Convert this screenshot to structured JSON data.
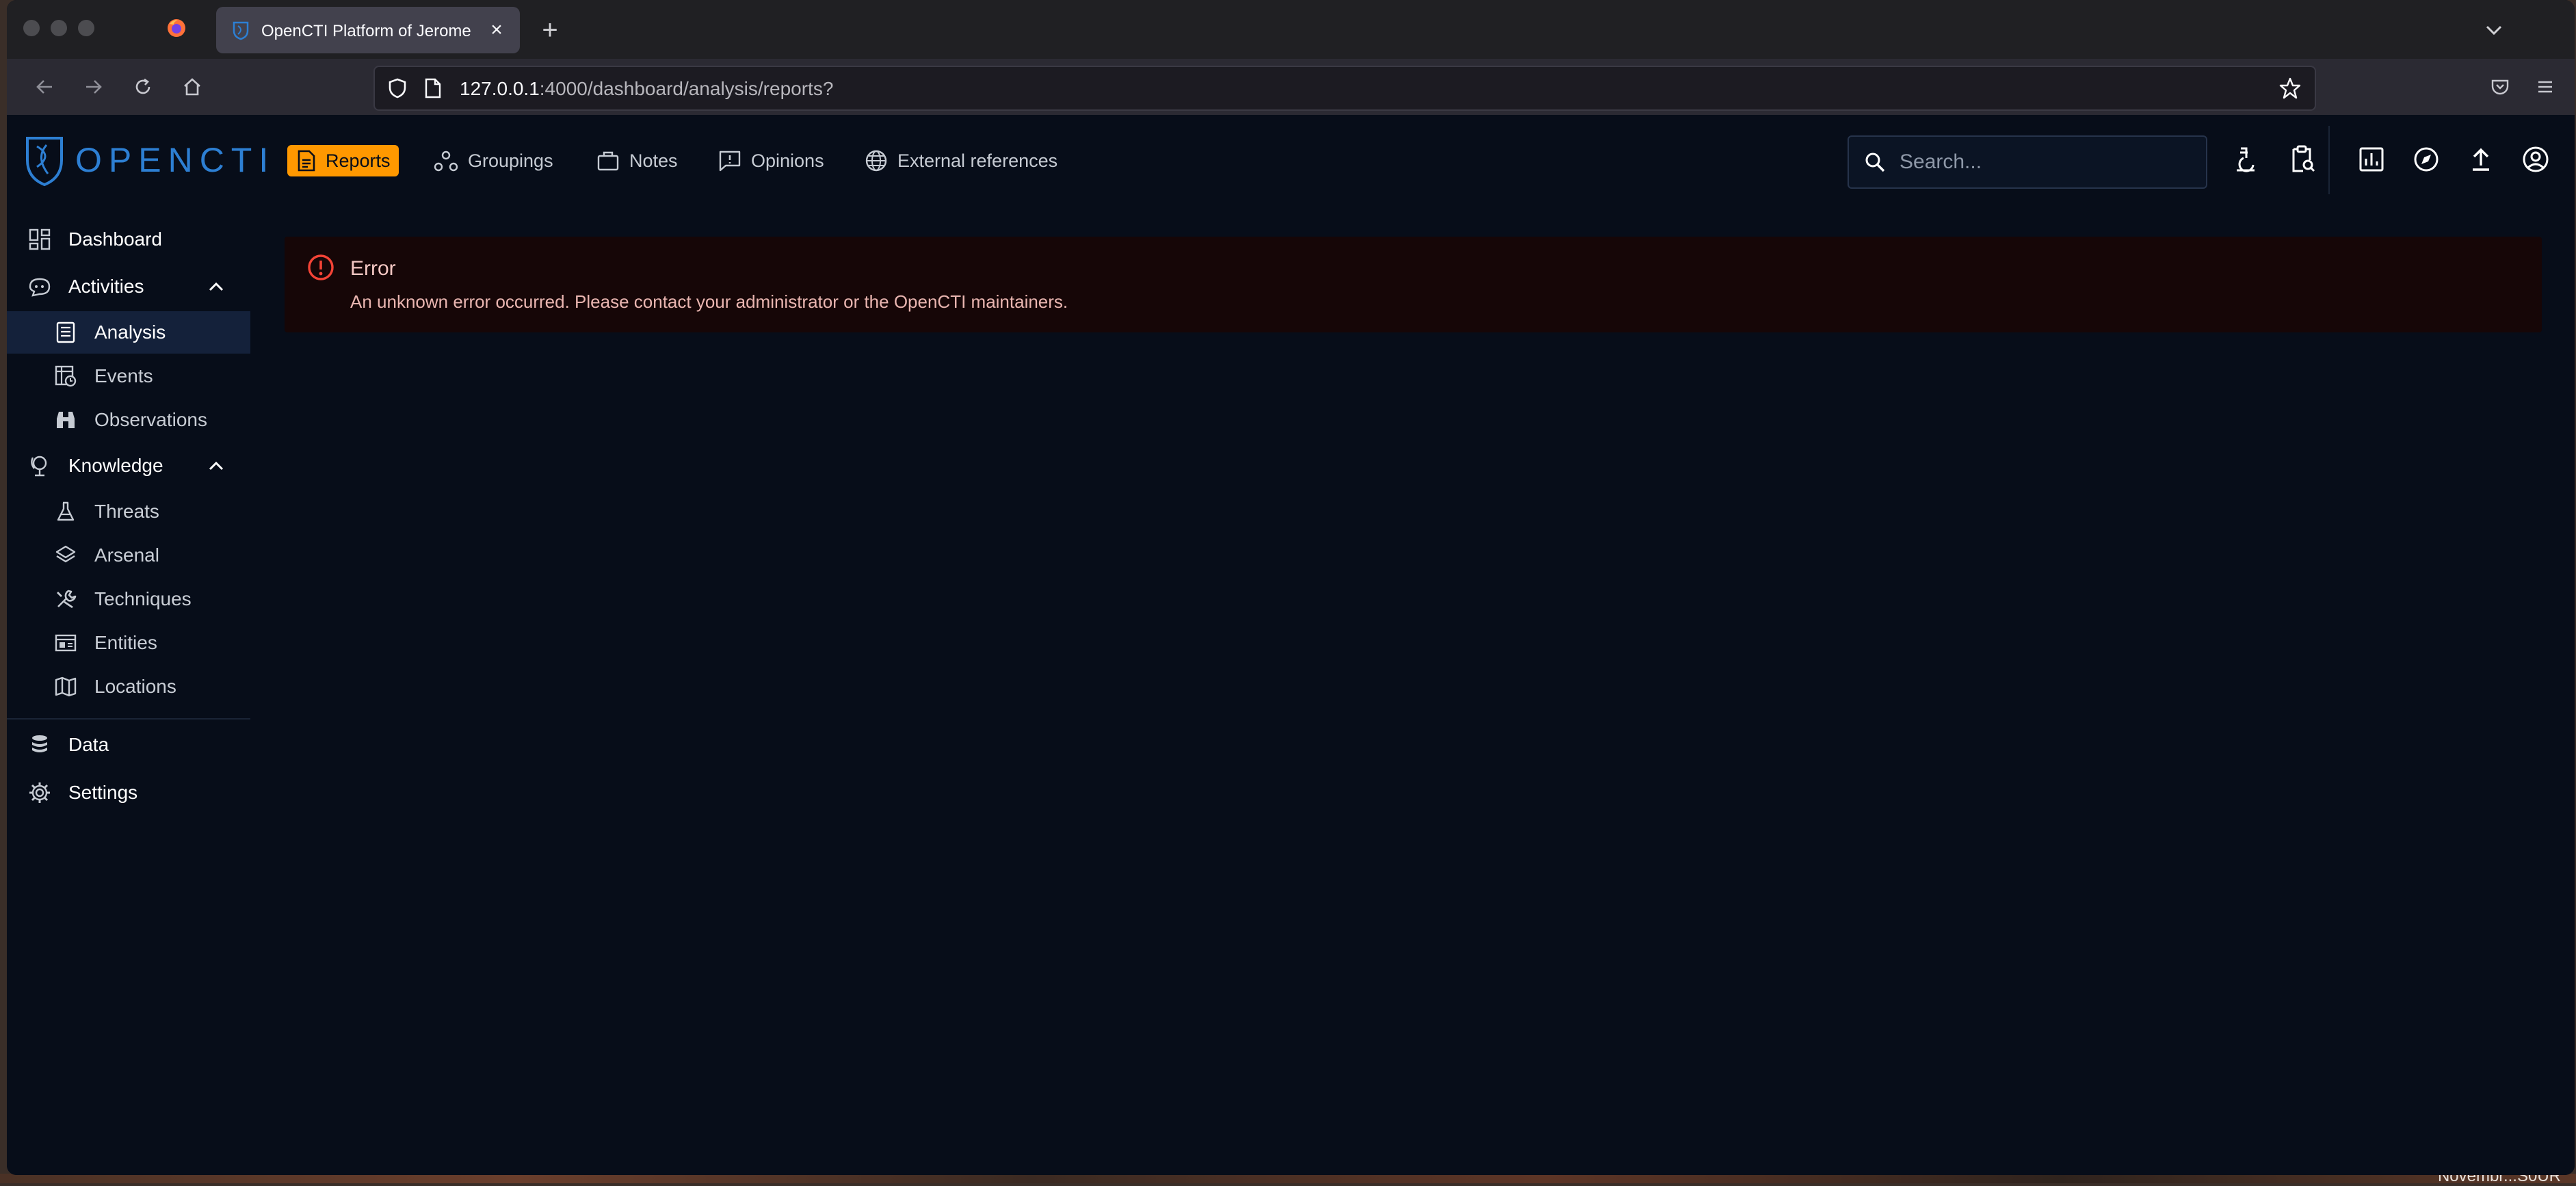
{
  "browser": {
    "tab_title": "OpenCTI Platform of Jerome",
    "url_host": "127.0.0.1",
    "url_rest": ":4000/dashboard/analysis/reports?"
  },
  "topbar": {
    "logo_text": "OPENCTI",
    "nav": [
      {
        "label": "Reports",
        "icon": "report-icon",
        "active": true
      },
      {
        "label": "Groupings",
        "icon": "groupings-icon"
      },
      {
        "label": "Notes",
        "icon": "notes-icon"
      },
      {
        "label": "Opinions",
        "icon": "opinions-icon"
      },
      {
        "label": "External references",
        "icon": "globe-icon"
      }
    ],
    "search_placeholder": "Search...",
    "accent_color": "#ff9800"
  },
  "sidebar": {
    "items": [
      {
        "label": "Dashboard",
        "icon": "dashboard-icon"
      },
      {
        "label": "Activities",
        "icon": "activities-icon",
        "expanded": true
      },
      {
        "label": "Analysis",
        "icon": "analysis-icon",
        "selected": true
      },
      {
        "label": "Events",
        "icon": "events-icon"
      },
      {
        "label": "Observations",
        "icon": "binoculars-icon"
      },
      {
        "label": "Knowledge",
        "icon": "knowledge-icon",
        "expanded": true
      },
      {
        "label": "Threats",
        "icon": "flask-icon"
      },
      {
        "label": "Arsenal",
        "icon": "layers-icon"
      },
      {
        "label": "Techniques",
        "icon": "tools-icon"
      },
      {
        "label": "Entities",
        "icon": "entities-icon"
      },
      {
        "label": "Locations",
        "icon": "map-icon"
      },
      {
        "label": "Data",
        "icon": "database-icon"
      },
      {
        "label": "Settings",
        "icon": "gear-icon"
      }
    ]
  },
  "alert": {
    "title": "Error",
    "message": "An unknown error occurred. Please contact your administrator or the OpenCTI maintainers.",
    "color": "#f44336"
  }
}
